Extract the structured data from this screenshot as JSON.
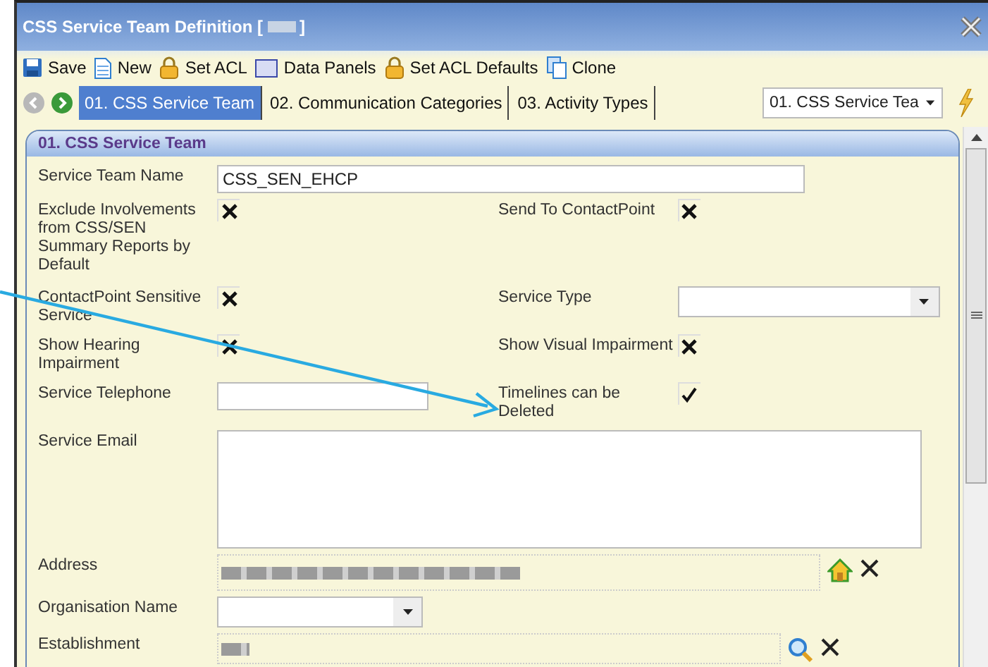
{
  "window": {
    "title": "CSS Service Team Definition [",
    "title_end": "]"
  },
  "toolbar": [
    {
      "label": "Save"
    },
    {
      "label": "New"
    },
    {
      "label": "Set ACL"
    },
    {
      "label": "Data Panels"
    },
    {
      "label": "Set ACL Defaults"
    },
    {
      "label": "Clone"
    }
  ],
  "tabs": [
    {
      "label": "01. CSS Service Team",
      "selected": true
    },
    {
      "label": "02. Communication Categories",
      "selected": false
    },
    {
      "label": "03. Activity Types",
      "selected": false
    }
  ],
  "page_select": {
    "value": "01. CSS Service Tea"
  },
  "panel": {
    "title": "01. CSS Service Team"
  },
  "rows": [
    {
      "cells": [
        {
          "label": "Service Team Name",
          "kind": "text",
          "value": "CSS_SEN_EHCP"
        }
      ]
    },
    {
      "cells": [
        {
          "label": "Exclude Involvements from CSS/SEN Summary Reports by Default",
          "kind": "crossbox",
          "checked": true
        },
        {
          "label": "Send To ContactPoint",
          "kind": "crossbox",
          "checked": true
        }
      ]
    },
    {
      "cells": [
        {
          "label": "ContactPoint Sensitive Service",
          "kind": "crossbox",
          "checked": true
        },
        {
          "label": "Service Type",
          "kind": "select"
        }
      ]
    },
    {
      "cells": [
        {
          "label": "Show Hearing Impairment",
          "kind": "crossbox",
          "checked": true
        },
        {
          "label": "Show Visual Impairment",
          "kind": "crossbox",
          "checked": true
        }
      ]
    },
    {
      "cells": [
        {
          "label": "Service Telephone",
          "kind": "text"
        },
        {
          "label": "Timelines can be Deleted",
          "kind": "tickbox",
          "checked": true
        }
      ]
    },
    {
      "cells": [
        {
          "label": "Service Email",
          "kind": "textarea"
        }
      ]
    },
    {
      "cells": [
        {
          "label": "Address",
          "kind": "address"
        }
      ]
    },
    {
      "cells": [
        {
          "label": "Organisation Name",
          "kind": "select"
        }
      ]
    },
    {
      "cells": [
        {
          "label": "Establishment",
          "kind": "search"
        }
      ]
    }
  ]
}
